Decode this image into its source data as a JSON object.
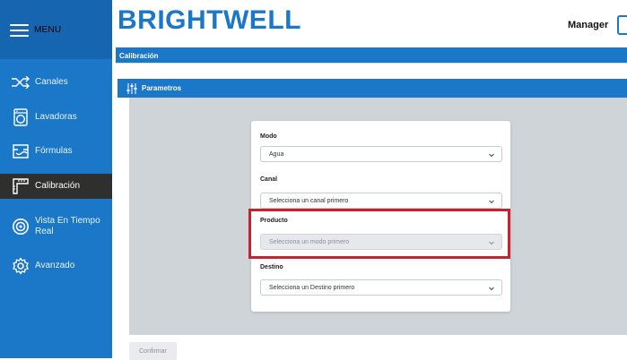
{
  "header": {
    "menu_label": "MENU",
    "logo": "BRIGHTWELL",
    "user": "Manager"
  },
  "sidebar": {
    "items": [
      {
        "label": "Canales",
        "icon": "shuffle-icon",
        "active": false
      },
      {
        "label": "Lavadoras",
        "icon": "washer-icon",
        "active": false
      },
      {
        "label": "Fórmulas",
        "icon": "formula-icon",
        "active": false
      },
      {
        "label": "Calibración",
        "icon": "calibration-icon",
        "active": true
      },
      {
        "label": "Vista En Tiempo Real",
        "icon": "eye-icon",
        "active": false
      },
      {
        "label": "Avanzado",
        "icon": "gear-icon",
        "active": false
      }
    ]
  },
  "page": {
    "title": "Calibración"
  },
  "section": {
    "title": "Parametros"
  },
  "form": {
    "modo": {
      "label": "Modo",
      "value": "Agua"
    },
    "canal": {
      "label": "Canal",
      "value": "Selecciona un canal primero"
    },
    "producto": {
      "label": "Producto",
      "value": "Selecciona un modo primero"
    },
    "destino": {
      "label": "Destino",
      "value": "Selecciona un Destino primero"
    }
  },
  "actions": {
    "confirm_label": "Confirmar"
  },
  "colors": {
    "brand": "#1b77c7",
    "highlight": "#c6232f",
    "active_nav": "#2f2f2f"
  }
}
